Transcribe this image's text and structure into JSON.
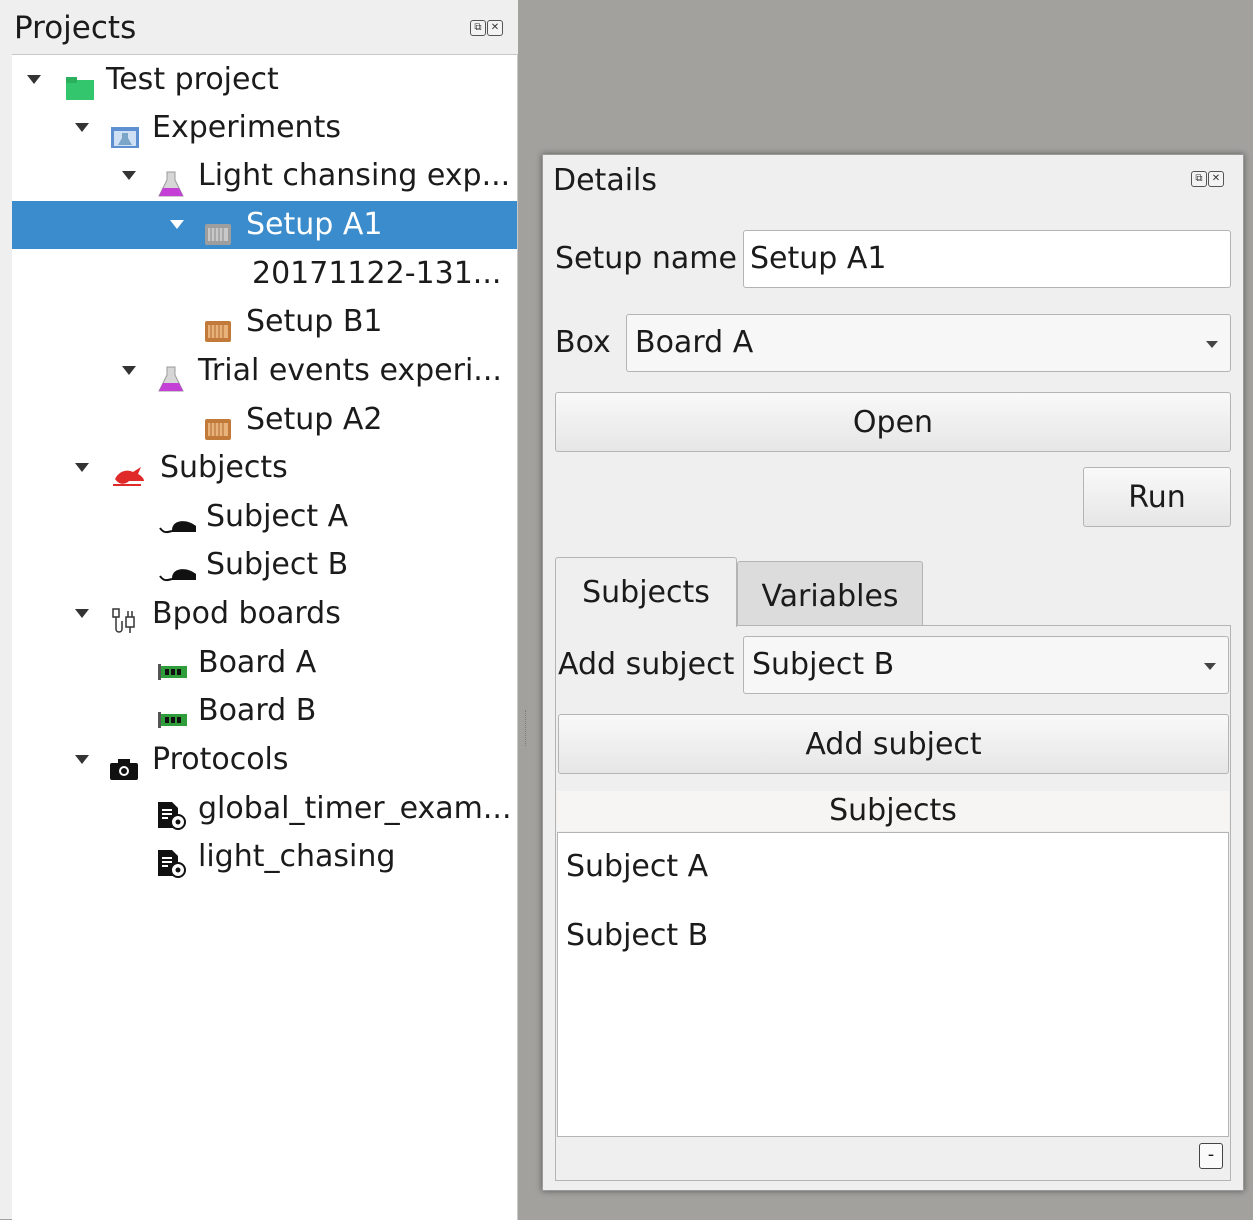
{
  "projects": {
    "title": "Projects",
    "float_icon": "⧉",
    "close_icon": "✕",
    "tree": [
      {
        "label": "Test project",
        "icon": "folder-icon"
      },
      {
        "label": "Experiments",
        "icon": "experiments-icon"
      },
      {
        "label": "Light chansing exp...",
        "icon": "flask-icon"
      },
      {
        "label": "Setup A1",
        "icon": "setup-icon",
        "selected": true
      },
      {
        "label": "20171122-131...",
        "icon": "none"
      },
      {
        "label": "Setup B1",
        "icon": "setup-icon"
      },
      {
        "label": "Trial events experi...",
        "icon": "flask-icon"
      },
      {
        "label": "Setup A2",
        "icon": "setup-icon"
      },
      {
        "label": "Subjects",
        "icon": "subjects-icon"
      },
      {
        "label": "Subject A",
        "icon": "mouse-icon"
      },
      {
        "label": "Subject B",
        "icon": "mouse-icon"
      },
      {
        "label": "Bpod boards",
        "icon": "plug-icon"
      },
      {
        "label": "Board A",
        "icon": "board-icon"
      },
      {
        "label": "Board B",
        "icon": "board-icon"
      },
      {
        "label": "Protocols",
        "icon": "camera-icon"
      },
      {
        "label": "global_timer_exam...",
        "icon": "protocol-icon"
      },
      {
        "label": "light_chasing",
        "icon": "protocol-icon"
      }
    ]
  },
  "details": {
    "title": "Details",
    "setup_name_label": "Setup name",
    "setup_name_value": "Setup A1",
    "box_label": "Box",
    "box_value": "Board A",
    "open_label": "Open",
    "run_label": "Run",
    "tabs": [
      {
        "label": "Subjects"
      },
      {
        "label": "Variables"
      }
    ],
    "add_subject_label": "Add subject",
    "add_subject_value": "Subject B",
    "add_subject_button": "Add subject",
    "list_header": "Subjects",
    "list_items": [
      "Subject A",
      "Subject B"
    ],
    "remove_label": "-"
  },
  "colors": {
    "selection": "#3b8ccc",
    "background": "#a3a19e"
  }
}
